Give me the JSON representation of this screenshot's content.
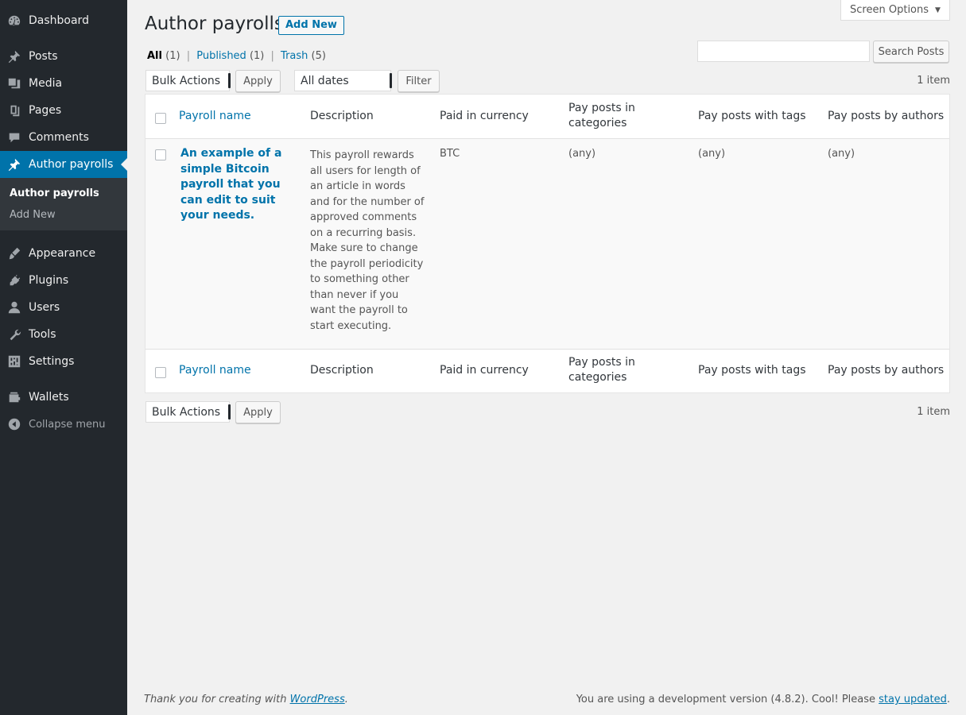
{
  "sidebar": {
    "items": [
      {
        "label": "Dashboard",
        "icon": "dashboard-icon"
      },
      {
        "label": "Posts",
        "icon": "pin-icon"
      },
      {
        "label": "Media",
        "icon": "media-icon"
      },
      {
        "label": "Pages",
        "icon": "pages-icon"
      },
      {
        "label": "Comments",
        "icon": "comment-icon"
      },
      {
        "label": "Author payrolls",
        "icon": "pin-icon"
      },
      {
        "label": "Appearance",
        "icon": "brush-icon"
      },
      {
        "label": "Plugins",
        "icon": "plug-icon"
      },
      {
        "label": "Users",
        "icon": "user-icon"
      },
      {
        "label": "Tools",
        "icon": "wrench-icon"
      },
      {
        "label": "Settings",
        "icon": "settings-icon"
      },
      {
        "label": "Wallets",
        "icon": "wallet-icon"
      }
    ],
    "submenu": {
      "current": "Author payrolls",
      "add_new": "Add New"
    },
    "collapse": "Collapse menu"
  },
  "header": {
    "title": "Author payrolls",
    "add_new": "Add New",
    "screen_options": "Screen Options"
  },
  "filters": {
    "all": "All",
    "all_count": "(1)",
    "published": "Published",
    "published_count": "(1)",
    "trash": "Trash",
    "trash_count": "(5)",
    "sep": "|"
  },
  "search": {
    "value": "",
    "button": "Search Posts"
  },
  "tablenav": {
    "bulk_actions": "Bulk Actions",
    "apply": "Apply",
    "dates": "All dates",
    "filter": "Filter",
    "items": "1 item"
  },
  "table": {
    "columns": [
      "Payroll name",
      "Description",
      "Paid in currency",
      "Pay posts in categories",
      "Pay posts with tags",
      "Pay posts by authors"
    ],
    "rows": [
      {
        "name": "An example of a simple Bitcoin payroll that you can edit to suit your needs.",
        "description": "This payroll rewards all users for length of an article in words and for the number of approved comments on a recurring basis. Make sure to change the payroll periodicity to something other than never if you want the payroll to start executing.",
        "currency": "BTC",
        "categories": "(any)",
        "tags": "(any)",
        "authors": "(any)"
      }
    ]
  },
  "footer": {
    "thanks_prefix": "Thank you for creating with ",
    "wordpress": "WordPress",
    "thanks_suffix": ".",
    "version_text": "You are using a development version (4.8.2). Cool! Please ",
    "stay_updated": "stay updated",
    "version_suffix": "."
  }
}
